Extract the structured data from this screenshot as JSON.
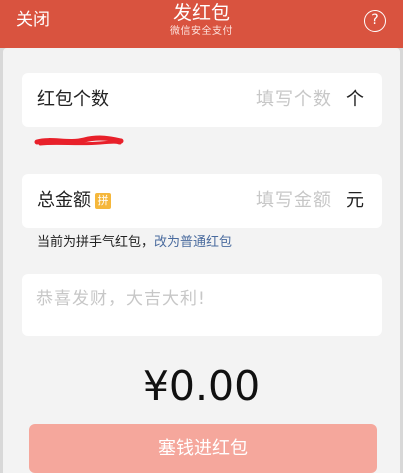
{
  "header": {
    "close_label": "关闭",
    "title": "发红包",
    "subtitle": "微信安全支付",
    "help_label": "?"
  },
  "count_field": {
    "label": "红包个数",
    "placeholder": "填写个数",
    "unit": "个"
  },
  "amount_field": {
    "label": "总金额",
    "badge": "拼",
    "placeholder": "填写金额",
    "unit": "元"
  },
  "hint": {
    "text": "当前为拼手气红包，",
    "link": "改为普通红包"
  },
  "greeting": {
    "placeholder": "恭喜发财，大吉大利!"
  },
  "total": "¥0.00",
  "submit_label": "塞钱进红包",
  "colors": {
    "header": "#d9533f",
    "submit": "#f5a79c",
    "link": "#4a6b9e",
    "badge": "#f5b73b",
    "scribble": "#e8202a"
  }
}
